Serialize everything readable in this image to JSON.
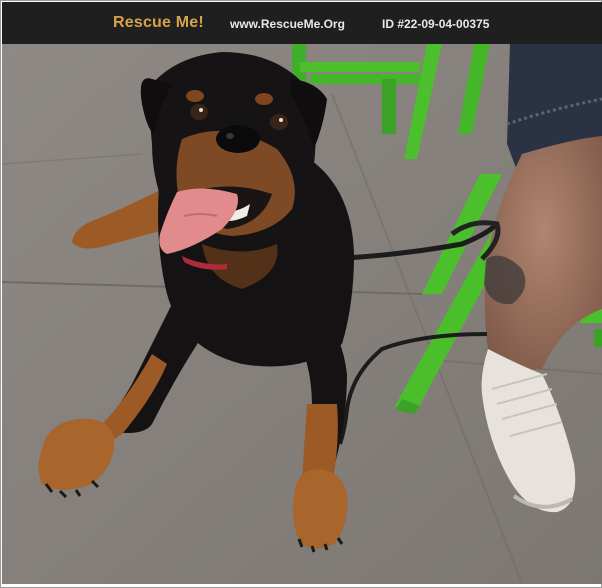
{
  "header": {
    "brand": "Rescue Me!",
    "site": "www.RescueMe.Org",
    "listing_id": "ID #22-09-04-00375"
  },
  "photo": {
    "subject": "rottweiler-dog-on-leash",
    "colors": {
      "header_bg": "#1f1f1f",
      "brand": "#d6a24a",
      "chair_green": "#4cc02c",
      "pavement": "#8a8580",
      "dog_black": "#141212",
      "dog_tan": "#9c5a26"
    }
  }
}
